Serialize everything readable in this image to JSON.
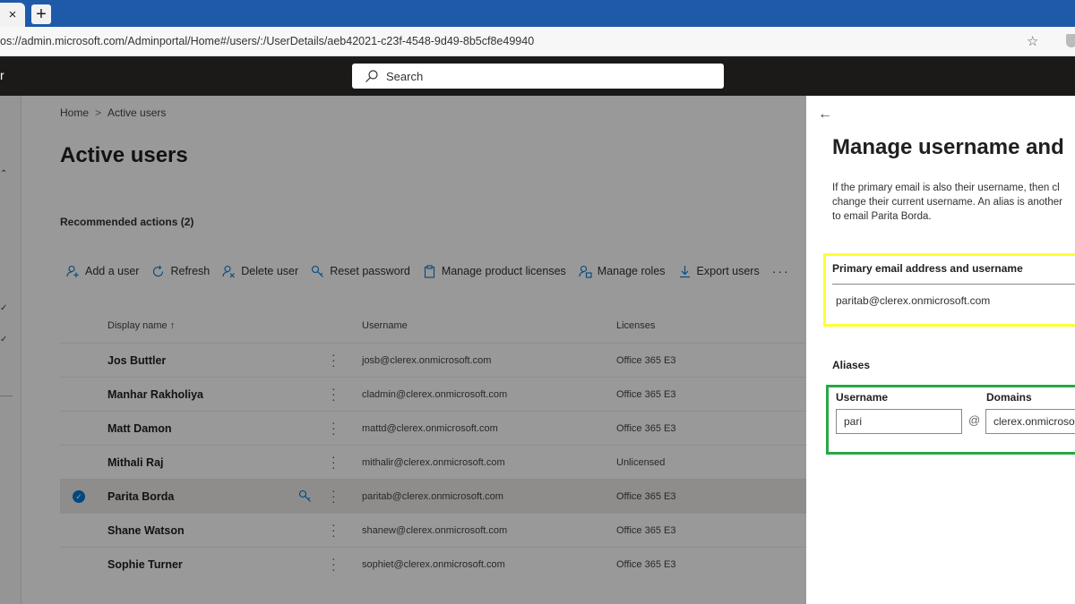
{
  "browser": {
    "tab_close": "×",
    "new_tab": "+",
    "url": "os://admin.microsoft.com/Adminportal/Home#/users/:/UserDetails/aeb42021-c23f-4548-9d49-8b5cf8e49940"
  },
  "appbar": {
    "brand": "r",
    "search_placeholder": "Search"
  },
  "breadcrumb": {
    "home": "Home",
    "current": "Active users"
  },
  "page_title": "Active users",
  "recommended": "Recommended actions (2)",
  "toolbar": {
    "add_user": "Add a user",
    "refresh": "Refresh",
    "delete_user": "Delete user",
    "reset_password": "Reset password",
    "manage_licenses": "Manage product licenses",
    "manage_roles": "Manage roles",
    "export_users": "Export users",
    "more": "···"
  },
  "table": {
    "headers": {
      "display_name": "Display name ↑",
      "username": "Username",
      "licenses": "Licenses"
    },
    "rows": [
      {
        "name": "Jos Buttler",
        "username": "josb@clerex.onmicrosoft.com",
        "license": "Office 365 E3"
      },
      {
        "name": "Manhar Rakholiya",
        "username": "cladmin@clerex.onmicrosoft.com",
        "license": "Office 365 E3"
      },
      {
        "name": "Matt Damon",
        "username": "mattd@clerex.onmicrosoft.com",
        "license": "Office 365 E3"
      },
      {
        "name": "Mithali Raj",
        "username": "mithalir@clerex.onmicrosoft.com",
        "license": "Unlicensed"
      },
      {
        "name": "Parita Borda",
        "username": "paritab@clerex.onmicrosoft.com",
        "license": "Office 365 E3"
      },
      {
        "name": "Shane Watson",
        "username": "shanew@clerex.onmicrosoft.com",
        "license": "Office 365 E3"
      },
      {
        "name": "Sophie Turner",
        "username": "sophiet@clerex.onmicrosoft.com",
        "license": "Office 365 E3"
      }
    ]
  },
  "panel": {
    "back": "←",
    "title": "Manage username and",
    "desc_line1": "If the primary email is also their username, then cl",
    "desc_line2": "change their current username. An alias is another",
    "desc_line3": "to email Parita Borda.",
    "primary_label": "Primary email address and username",
    "primary_value": "paritab@clerex.onmicrosoft.com",
    "aliases_label": "Aliases",
    "username_label": "Username",
    "username_value": "pari",
    "at": "@",
    "domains_label": "Domains",
    "domain_value": "clerex.onmicrosoft.com"
  },
  "colors": {
    "highlight_yellow": "#ffff33",
    "highlight_green": "#27a844",
    "accent": "#0078d4"
  }
}
